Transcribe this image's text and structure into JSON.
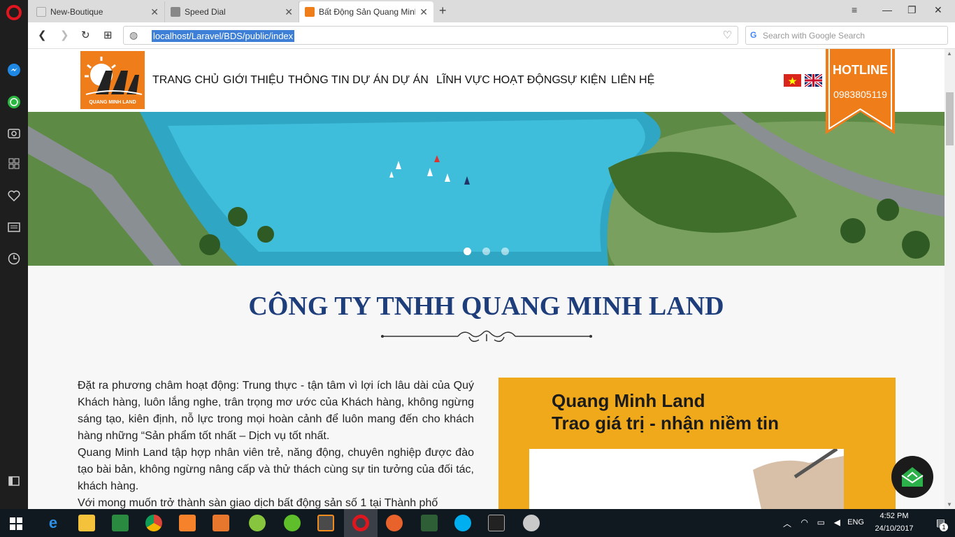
{
  "browser": {
    "tabs": [
      {
        "label": "New-Boutique",
        "active": false
      },
      {
        "label": "Speed Dial",
        "active": false
      },
      {
        "label": "Bất Động Sản Quang Minh",
        "active": true
      }
    ],
    "url": "localhost/Laravel/BDS/public/index",
    "search_placeholder": "Search with Google Search"
  },
  "site": {
    "logo_text": "QUANG MINH LAND",
    "menu": [
      "TRANG CHỦ",
      "GIỚI THIỆU",
      "THÔNG TIN DỰ ÁN",
      "DỰ ÁN",
      "LĨNH VỰC HOẠT ĐỘNG",
      "SỰ KIỆN",
      "LIÊN HỆ"
    ],
    "hotline_label": "HOTLINE",
    "hotline_number": "0983805119",
    "company_title": "CÔNG TY TNHH QUANG MINH LAND",
    "about_paragraphs": [
      "Đặt ra phương châm hoạt động: Trung thực - tận tâm vì lợi ích lâu dài của Quý Khách hàng, luôn lắng nghe, trân trọng mơ ước của Khách hàng, không ngừng sáng tạo, kiên định, nỗ lực trong mọi hoàn cảnh để luôn mang đến cho khách hàng những “Sản phẩm tốt nhất – Dịch vụ tốt nhất.",
      "Quang Minh Land tập hợp nhân viên trẻ, năng động, chuyên nghiệp được đào tạo bài bản, không ngừng nâng cấp và thử thách cùng sự tin tưởng của đối tác, khách hàng.",
      "Với mong muốn trở thành sàn giao dịch bất động sản số 1 tại Thành phố"
    ],
    "promo_line1": "Quang Minh Land",
    "promo_line2": "Trao giá trị - nhận niềm tin",
    "slider_dots": 3,
    "slider_active": 0
  },
  "taskbar": {
    "language": "ENG",
    "time": "4:52 PM",
    "date": "24/10/2017",
    "notification_count": "1"
  },
  "colors": {
    "brand_orange": "#ee7d1a",
    "title_blue": "#1e3d7b",
    "promo_yellow": "#f1a91c"
  }
}
